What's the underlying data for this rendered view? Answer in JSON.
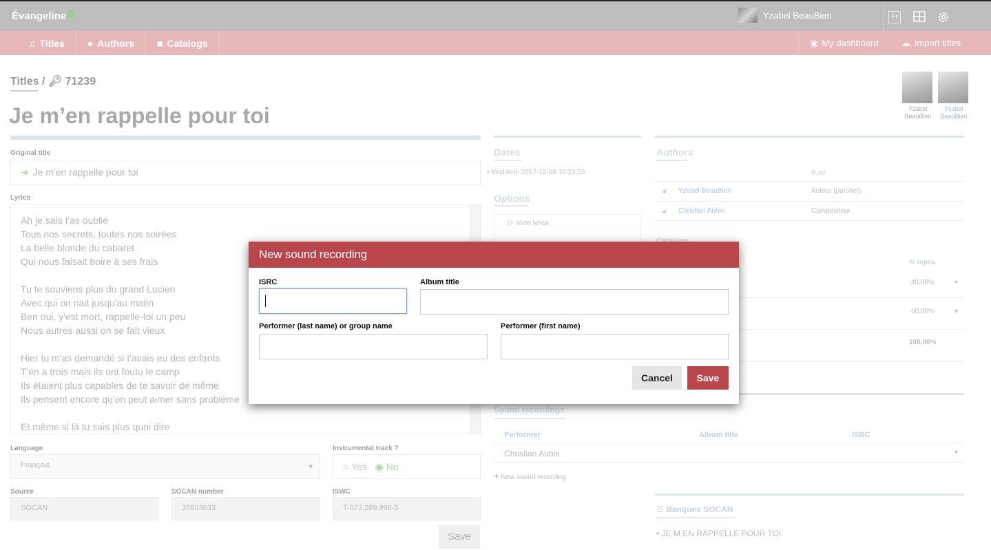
{
  "app": {
    "brand": "Évangeline",
    "user_name": "Yzabel BeauBien",
    "lang": "Fr"
  },
  "nav": {
    "left": [
      {
        "label": "Titles",
        "icon": "music-icon"
      },
      {
        "label": "Authors",
        "icon": "user-circle-icon"
      },
      {
        "label": "Catalogs",
        "icon": "book-icon"
      }
    ],
    "right": [
      {
        "label": "My dashboard",
        "icon": "dashboard-icon"
      },
      {
        "label": "Import titles",
        "icon": "cloud-upload-icon"
      }
    ]
  },
  "page": {
    "breadcrumb_root": "Titles /",
    "breadcrumb_id": "71239",
    "title": "Je m’en rappelle pour toi",
    "contributors": [
      {
        "name": "Yzabel BeauBien"
      },
      {
        "name": "Yzabel BeauBien"
      }
    ]
  },
  "form": {
    "original_title_label": "Original title",
    "original_title_value": "Je m'en rappelle pour toi",
    "lyrics_label": "Lyrics",
    "lyrics": "Ah je sais t'as oublié\nTous nos secrets, toutes nos soirées\nLa belle blonde du cabaret\nQui nous faisait boire à ses frais\n\nTu te souviens plus du grand Lucien\nAvec qui on riait jusqu'au matin\nBen oui, y'est mort, rappelle-toi un peu\nNous autres aussi on se fait vieux\n\nHier tu m'as demandé si t'avais eu des enfants\nT'en a trois mais ils ont foutu le camp\nIls étaient plus capables de te savoir de même\nIls pensent encore qu'on peut aimer sans problème\n\nEt même si là tu sais plus quoi dire",
    "language_label": "Language",
    "language_value": "Français",
    "instrumental_label": "Instrumental track ?",
    "instrumental_yes": "Yes",
    "instrumental_no": "No",
    "source_label": "Source",
    "source_value": "SOCAN",
    "socan_label": "SOCAN number",
    "socan_value": "35803633",
    "iswc_label": "ISWC",
    "iswc_value": "T-073.269.996-5",
    "save_label": "Save"
  },
  "sidebar": {
    "dates_title": "Dates",
    "modified": "Modified: 2017-12-08 16:23:55",
    "options_title": "Options",
    "view_lyrics": "View lyrics",
    "authors_title": "Authors",
    "role_header": "Role",
    "authors": [
      {
        "name": "Yzabel BeauBien",
        "role": "Auteur (parolier)"
      },
      {
        "name": "Christian Aubin",
        "role": "Compositeur"
      }
    ],
    "catalogs_title": "Catalogs",
    "repro_header": "% repro.",
    "repro_values": [
      "40,00%",
      "60,00%"
    ],
    "repro_total": "100,00%",
    "recordings_title": "Sound recordings",
    "rec_headers": [
      "Performer",
      "Album title",
      "ISRC"
    ],
    "rec_rows": [
      {
        "performer": "Christian Aubin"
      }
    ],
    "new_recording": "New sound recording",
    "socan_bank_title": "Banques SOCAN",
    "socan_bank_items": [
      "JE M EN RAPPELLE POUR TOI"
    ]
  },
  "modal": {
    "title": "New sound recording",
    "isrc_label": "ISRC",
    "isrc_value": "",
    "album_label": "Album title",
    "album_value": "",
    "performer_last_label": "Performer (last name) or group name",
    "performer_last_value": "",
    "performer_first_label": "Performer (first name)",
    "performer_first_value": "",
    "cancel_label": "Cancel",
    "save_label": "Save"
  },
  "colors": {
    "accent": "#b8464a",
    "topbar": "#bdbdbd",
    "navbar": "#e7b8b9"
  }
}
